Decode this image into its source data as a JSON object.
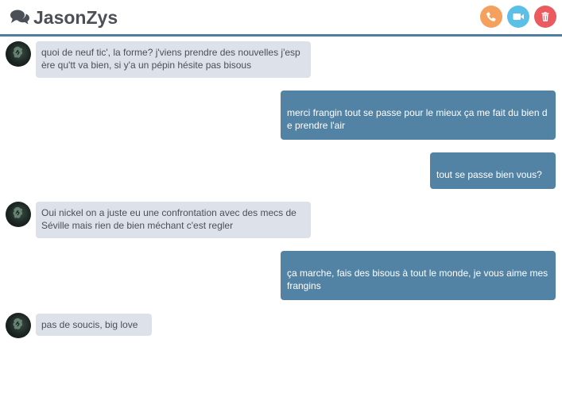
{
  "header": {
    "title": "JasonZys",
    "chat_icon": "comments-icon",
    "buttons": [
      {
        "name": "phone-icon",
        "color": "#f5a05d"
      },
      {
        "name": "video-camera-icon",
        "color": "#5bc0e8"
      },
      {
        "name": "trash-icon",
        "color": "#ea5a5f"
      }
    ]
  },
  "colors": {
    "accent_line": "#4f7fa0",
    "incoming_bubble": "#dde1ea",
    "outgoing_bubble": "#5383a4"
  },
  "messages": [
    {
      "direction": "incoming",
      "text": "quoi de neuf tic', la forme? j'viens prendre des nouvelles j'espère qu'tt va bien, si y'a un pépin hésite pas bisous"
    },
    {
      "direction": "outgoing",
      "text": "merci frangin tout se passe pour le mieux ça me fait du bien de prendre l'air"
    },
    {
      "direction": "outgoing",
      "text": "tout se passe bien vous?"
    },
    {
      "direction": "incoming",
      "text": "Oui nickel on a juste eu une confrontation avec des mecs de Séville mais rien de bien méchant c'est regler"
    },
    {
      "direction": "outgoing",
      "text": "ça marche, fais des bisous à tout le monde, je vous aime mes frangins"
    },
    {
      "direction": "incoming",
      "text": "pas de soucis, big love"
    }
  ]
}
